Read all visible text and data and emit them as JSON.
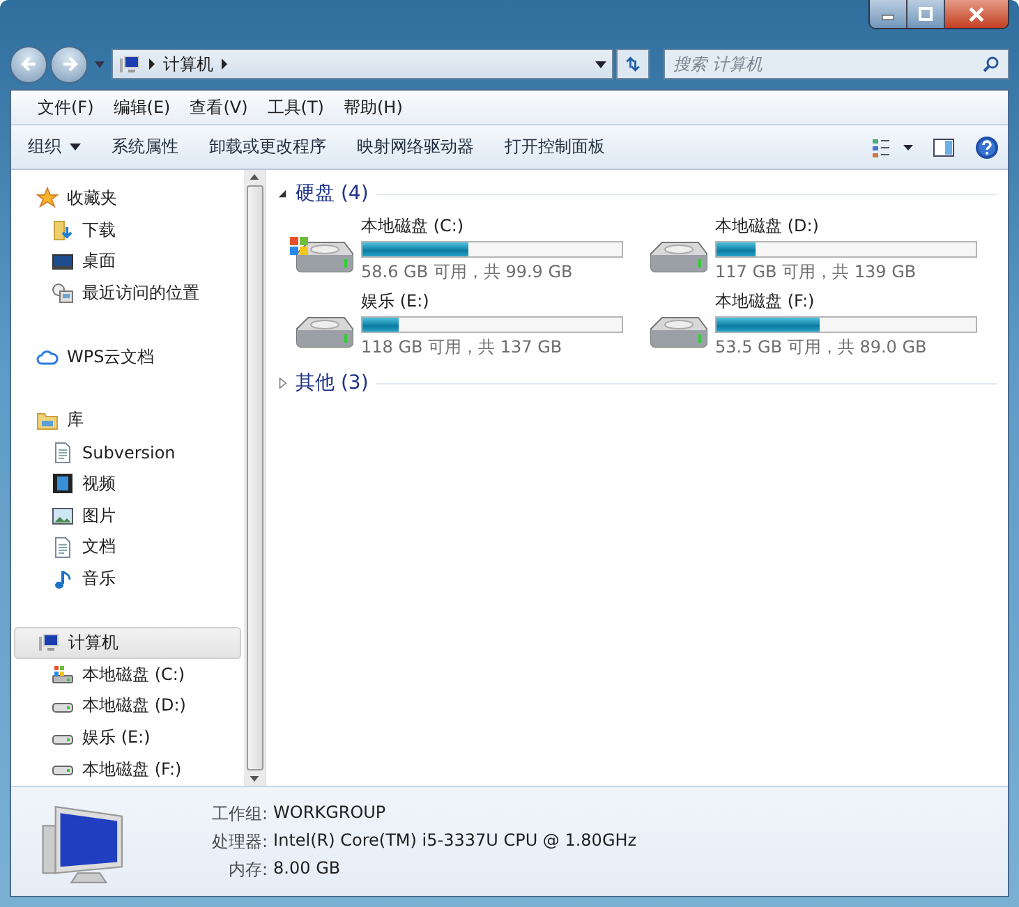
{
  "address": {
    "path": "计算机"
  },
  "search": {
    "placeholder": "搜索 计算机"
  },
  "menu": [
    "文件(F)",
    "编辑(E)",
    "查看(V)",
    "工具(T)",
    "帮助(H)"
  ],
  "toolbar": [
    {
      "label": "组织",
      "dropdown": true
    },
    {
      "label": "系统属性",
      "dropdown": false
    },
    {
      "label": "卸载或更改程序",
      "dropdown": false
    },
    {
      "label": "映射网络驱动器",
      "dropdown": false
    },
    {
      "label": "打开控制面板",
      "dropdown": false
    }
  ],
  "sidebar": {
    "items": [
      {
        "label": "收藏夹",
        "selected": false,
        "children": [
          {
            "label": "下载",
            "selected": false
          },
          {
            "label": "桌面",
            "selected": false
          },
          {
            "label": "最近访问的位置",
            "selected": false
          }
        ]
      },
      {
        "label": "WPS云文档",
        "selected": false
      },
      {
        "label": "库",
        "selected": false,
        "children": [
          {
            "label": "Subversion",
            "selected": false
          },
          {
            "label": "视频",
            "selected": false
          },
          {
            "label": "图片",
            "selected": false
          },
          {
            "label": "文档",
            "selected": false
          },
          {
            "label": "音乐",
            "selected": false
          }
        ]
      },
      {
        "label": "计算机",
        "selected": true,
        "children": [
          {
            "label": "本地磁盘 (C:)",
            "selected": false
          },
          {
            "label": "本地磁盘 (D:)",
            "selected": false
          },
          {
            "label": "娱乐 (E:)",
            "selected": false
          },
          {
            "label": "本地磁盘 (F:)",
            "selected": false
          }
        ]
      }
    ]
  },
  "groups": [
    {
      "title": "硬盘 (4)",
      "expanded": true,
      "drives": [
        {
          "name": "本地磁盘 (C:)",
          "kind": "system",
          "level": 0.41,
          "info": "58.6 GB 可用，共 99.9 GB"
        },
        {
          "name": "本地磁盘 (D:)",
          "kind": "local",
          "level": 0.15,
          "info": "117 GB 可用，共 139 GB"
        },
        {
          "name": "娱乐 (E:)",
          "kind": "local",
          "level": 0.14,
          "info": "118 GB 可用，共 137 GB"
        },
        {
          "name": "本地磁盘 (F:)",
          "kind": "local",
          "level": 0.4,
          "info": "53.5 GB 可用，共 89.0 GB"
        }
      ]
    },
    {
      "title": "其他 (3)",
      "expanded": false
    }
  ],
  "details": [
    {
      "label": "工作组:",
      "value": "WORKGROUP"
    },
    {
      "label": "处理器:",
      "value": "Intel(R) Core(TM) i5-3337U CPU @ 1.80GHz"
    },
    {
      "label": "内存:",
      "value": "8.00 GB"
    }
  ]
}
